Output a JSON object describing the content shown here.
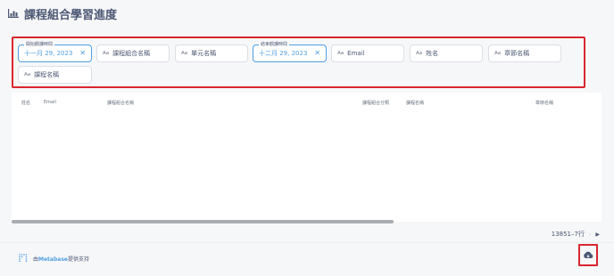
{
  "header": {
    "title": "課程組合學習進度",
    "icon": "bar-chart-icon"
  },
  "filters": {
    "start_date": {
      "legend": "開始觀課時間",
      "value": "十一月 29, 2023"
    },
    "course_combo_name": "課程組合名稱",
    "unit_name": "單元名稱",
    "end_date": {
      "legend": "結束觀課時間",
      "value": "十二月 29, 2023"
    },
    "email": "Email",
    "name": "姓名",
    "chapter_name": "章節名稱",
    "course_name": "課程名稱",
    "aa_prefix": "Aa"
  },
  "table": {
    "columns": [
      "姓名",
      "Email",
      "課程組合名稱",
      "課程組合分類",
      "課程名稱",
      "章節名稱"
    ]
  },
  "pager": {
    "range": "13851–7行",
    "prev": "‹",
    "next": "›"
  },
  "footer": {
    "powered_prefix": "由",
    "brand": "Metabase",
    "powered_suffix": "提供支持"
  },
  "colors": {
    "accent": "#509ee3",
    "highlight": "#d9262f"
  }
}
